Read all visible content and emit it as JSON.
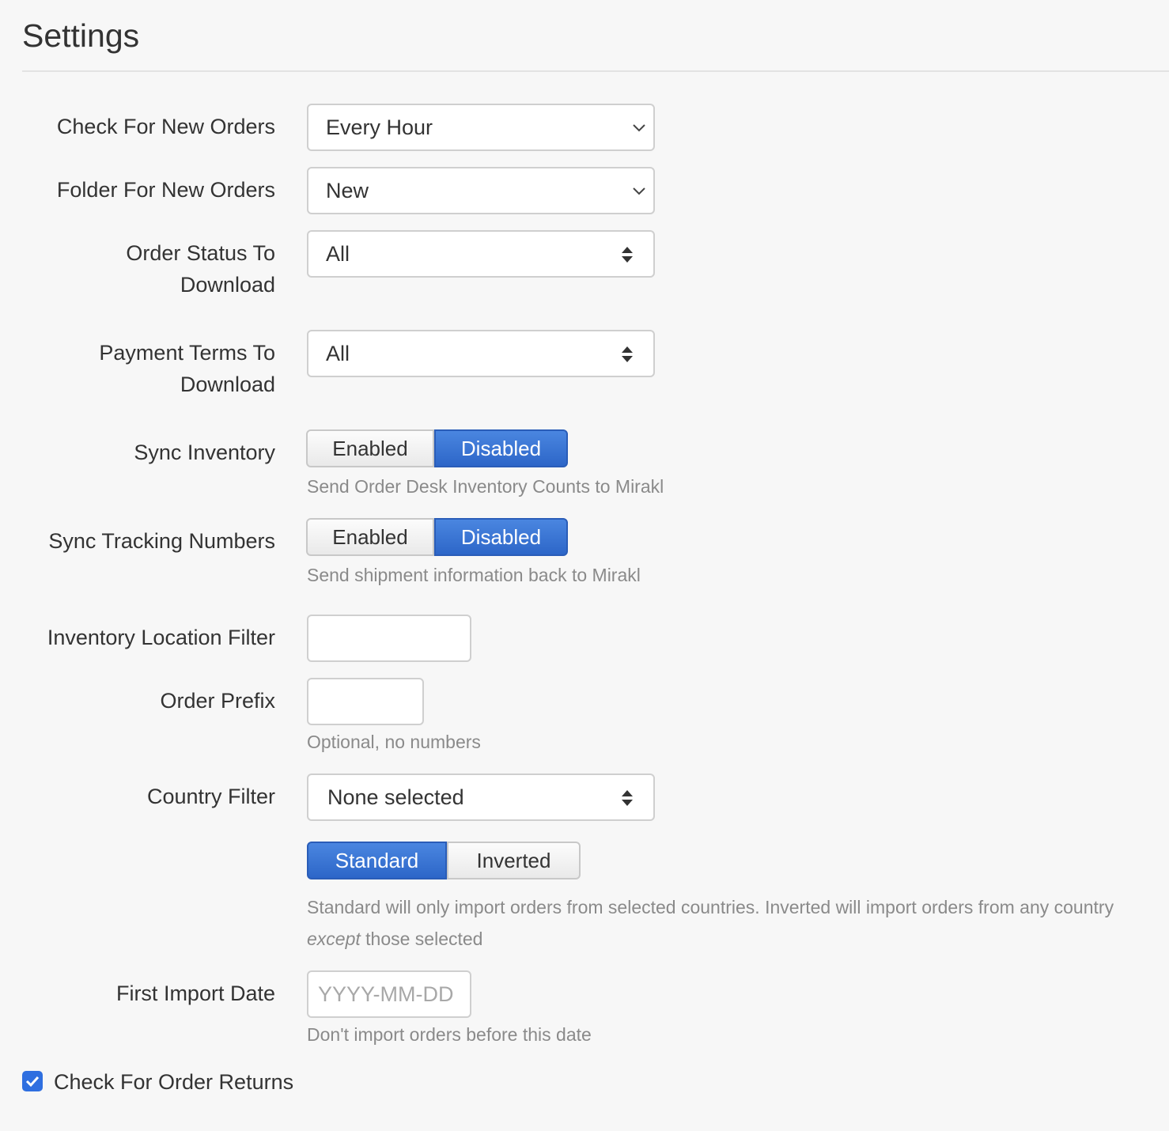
{
  "page": {
    "title": "Settings"
  },
  "check_new_orders": {
    "label": "Check For New Orders",
    "value": "Every Hour"
  },
  "folder_new_orders": {
    "label": "Folder For New Orders",
    "value": "New"
  },
  "order_status": {
    "label_line1": "Order Status To",
    "label_line2": "Download",
    "value": "All"
  },
  "payment_terms": {
    "label_line1": "Payment Terms To",
    "label_line2": "Download",
    "value": "All"
  },
  "sync_inventory": {
    "label": "Sync Inventory",
    "enabled_label": "Enabled",
    "disabled_label": "Disabled",
    "selected": "Disabled",
    "help": "Send Order Desk Inventory Counts to Mirakl"
  },
  "sync_tracking": {
    "label": "Sync Tracking Numbers",
    "enabled_label": "Enabled",
    "disabled_label": "Disabled",
    "selected": "Disabled",
    "help": "Send shipment information back to Mirakl"
  },
  "inventory_location": {
    "label": "Inventory Location Filter",
    "value": ""
  },
  "order_prefix": {
    "label": "Order Prefix",
    "value": "",
    "help": "Optional, no numbers"
  },
  "country_filter": {
    "label": "Country Filter",
    "value": "None selected",
    "standard_label": "Standard",
    "inverted_label": "Inverted",
    "selected_mode": "Standard",
    "help_line1": "Standard will only import orders from selected countries. Inverted will import orders from any country",
    "help_em": "except",
    "help_line2_rest": " those selected"
  },
  "first_import_date": {
    "label": "First Import Date",
    "value": "",
    "placeholder": "YYYY-MM-DD",
    "help": "Don't import orders before this date"
  },
  "check_returns": {
    "label": "Check For Order Returns",
    "checked": true
  },
  "colors": {
    "accent": "#2f6fe0",
    "help_text": "#8a8a8a"
  }
}
